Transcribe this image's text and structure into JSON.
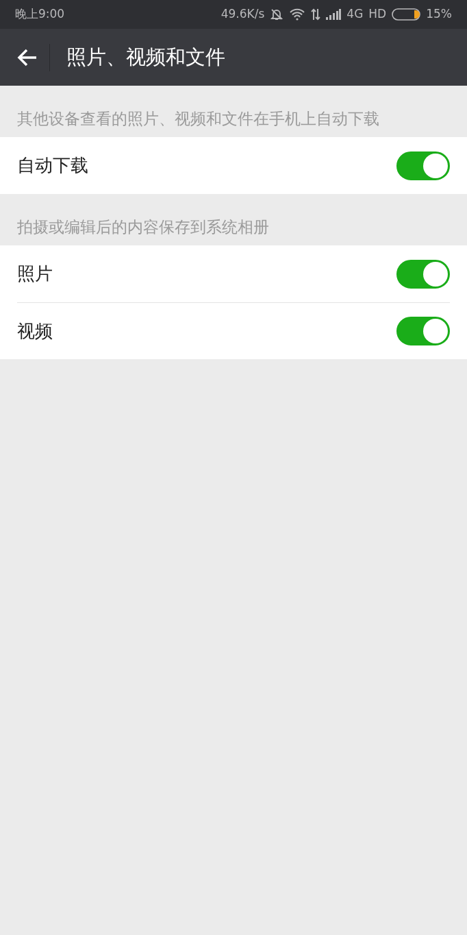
{
  "status_bar": {
    "time": "晚上9:00",
    "speed": "49.6K/s",
    "network": "4G",
    "hd": "HD",
    "battery": "15%"
  },
  "title_bar": {
    "title": "照片、视频和文件"
  },
  "sections": [
    {
      "header": "其他设备查看的照片、视频和文件在手机上自动下载",
      "items": [
        {
          "label": "自动下载",
          "on": true
        }
      ]
    },
    {
      "header": "拍摄或编辑后的内容保存到系统相册",
      "items": [
        {
          "label": "照片",
          "on": true
        },
        {
          "label": "视频",
          "on": true
        }
      ]
    }
  ]
}
